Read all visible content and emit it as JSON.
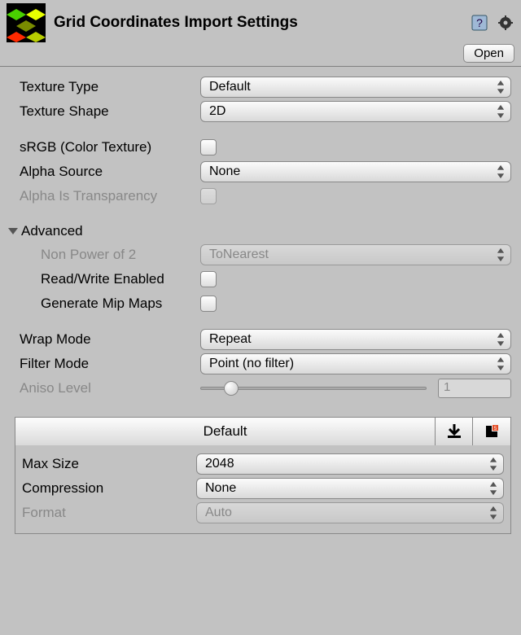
{
  "header": {
    "title": "Grid Coordinates Import Settings",
    "open_label": "Open"
  },
  "texture": {
    "type_label": "Texture Type",
    "type_value": "Default",
    "shape_label": "Texture Shape",
    "shape_value": "2D"
  },
  "color": {
    "srgb_label": "sRGB (Color Texture)",
    "alpha_source_label": "Alpha Source",
    "alpha_source_value": "None",
    "alpha_is_transparency_label": "Alpha Is Transparency"
  },
  "advanced": {
    "heading": "Advanced",
    "npot_label": "Non Power of 2",
    "npot_value": "ToNearest",
    "rw_label": "Read/Write Enabled",
    "mip_label": "Generate Mip Maps"
  },
  "sampling": {
    "wrap_label": "Wrap Mode",
    "wrap_value": "Repeat",
    "filter_label": "Filter Mode",
    "filter_value": "Point (no filter)",
    "aniso_label": "Aniso Level",
    "aniso_value": "1"
  },
  "platform": {
    "default_tab": "Default",
    "maxsize_label": "Max Size",
    "maxsize_value": "2048",
    "compression_label": "Compression",
    "compression_value": "None",
    "format_label": "Format",
    "format_value": "Auto"
  }
}
